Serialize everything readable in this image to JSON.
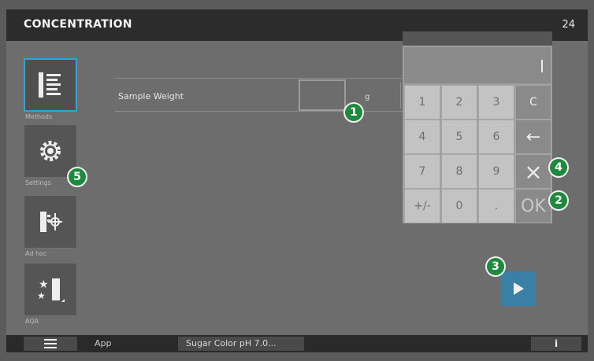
{
  "header": {
    "title": "CONCENTRATION",
    "clock": "24"
  },
  "sidebar": {
    "items": [
      {
        "label": "Methods",
        "icon": "methods-list-icon"
      },
      {
        "label": "Settings",
        "icon": "gear-icon"
      },
      {
        "label": "Ad hoc",
        "icon": "adhoc-icon"
      },
      {
        "label": "AQA",
        "icon": "aqa-stars-icon"
      }
    ]
  },
  "form": {
    "sample_weight_label": "Sample Weight",
    "sample_weight_value": "",
    "unit": "g"
  },
  "keypad": {
    "keys": [
      "1",
      "2",
      "3",
      "C",
      "4",
      "5",
      "6",
      "←",
      "7",
      "8",
      "9",
      "×",
      "+/-",
      "0",
      ".",
      "OK"
    ]
  },
  "callouts": [
    "1",
    "2",
    "3",
    "4",
    "5"
  ],
  "bottom": {
    "app_label": "App",
    "method_field": "Sugar Color pH 7.0...",
    "info_label": "i"
  },
  "colors": {
    "accent": "#2aa7d8",
    "callout": "#1f8a3d",
    "play": "#3a7fa6"
  }
}
